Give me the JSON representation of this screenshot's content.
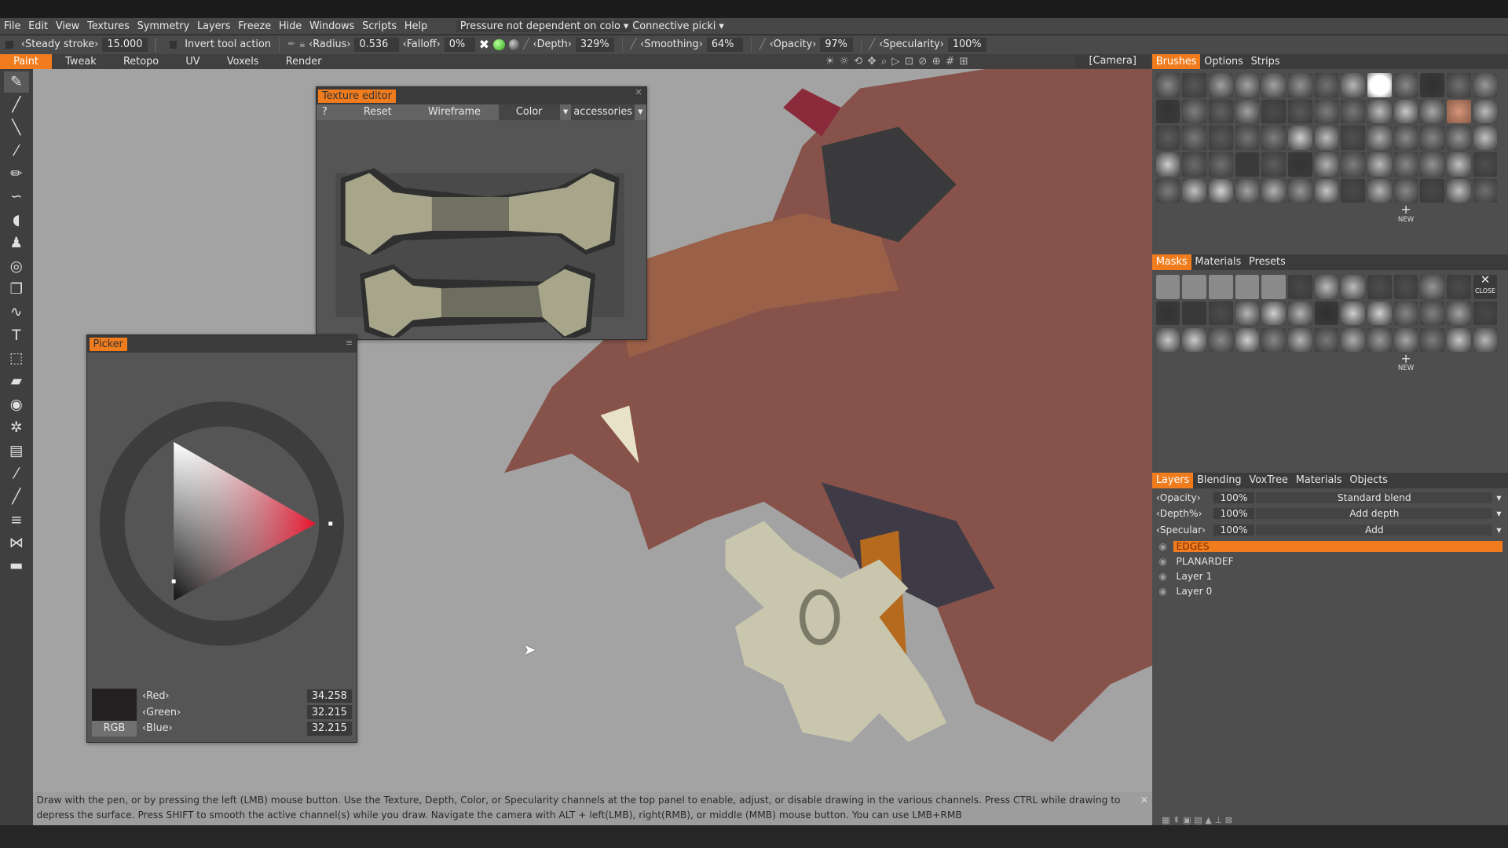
{
  "menu": [
    "File",
    "Edit",
    "View",
    "Textures",
    "Symmetry",
    "Layers",
    "Freeze",
    "Hide",
    "Windows",
    "Scripts",
    "Help"
  ],
  "menu_dropdowns": [
    "Pressure not dependent on colo",
    "Connective picki"
  ],
  "toolbar": {
    "steady_stroke_label": "‹Steady stroke›",
    "steady_stroke_value": "15.000",
    "invert_label": "Invert tool action",
    "radius_label": "‹Radius›",
    "radius_value": "0.536",
    "falloff_label": "‹Falloff›",
    "falloff_value": "0%",
    "depth_label": "‹Depth›",
    "depth_value": "329%",
    "smoothing_label": "‹Smoothing›",
    "smoothing_value": "64%",
    "opacity_label": "‹Opacity›",
    "opacity_value": "97%",
    "specularity_label": "‹Specularity›",
    "specularity_value": "100%"
  },
  "rooms": [
    "Paint",
    "Tweak",
    "Retopo",
    "UV",
    "Voxels",
    "Render"
  ],
  "active_room": "Paint",
  "camera": "[Camera]",
  "view_icons": [
    "☀",
    "☼",
    "⟲",
    "✥",
    "⌕",
    "▷",
    "⊡",
    "⊘",
    "⊕",
    "#",
    "⊞"
  ],
  "left_tools": [
    "brush-icon",
    "pen-icon",
    "line-icon",
    "airbrush-icon",
    "pencil-icon",
    "smudge-icon",
    "fill-icon",
    "clone-icon",
    "lasso-icon",
    "copy-icon",
    "curve-icon",
    "text-icon",
    "transform-icon",
    "eraser-icon",
    "eye-icon",
    "gear-icon",
    "ruler-icon",
    "picker-icon",
    "knife-icon",
    "stamp-icon",
    "butterfly-icon",
    "measure-icon"
  ],
  "left_tool_glyphs": [
    "✎",
    "╱",
    "╲",
    "⁄",
    "✏",
    "∽",
    "◖",
    "♟",
    "◎",
    "❐",
    "∿",
    "T",
    "⬚",
    "▰",
    "◉",
    "✲",
    "▤",
    "⁄",
    "╱",
    "≡",
    "⋈",
    "▬"
  ],
  "texture_editor": {
    "title": "Texture editor",
    "help": "?",
    "reset": "Reset",
    "wireframe": "Wireframe",
    "channel": "Color",
    "object": "accessories"
  },
  "picker": {
    "title": "Picker",
    "mode": "RGB",
    "red_label": "‹Red›",
    "red": "34.258",
    "green_label": "‹Green›",
    "green": "32.215",
    "blue_label": "‹Blue›",
    "blue": "32.215",
    "swatch": "#222020",
    "hue": "#e8102a"
  },
  "status": "Draw with the pen, or by pressing the left (LMB) mouse button. Use the Texture, Depth, Color, or Specularity channels at the top panel to enable, adjust, or disable drawing in the various channels. Press CTRL while drawing to depress the surface. Press SHIFT to smooth the active channel(s) while you draw. Navigate the camera with ALT + left(LMB), right(RMB), or middle (MMB) mouse button. You can use LMB+RMB",
  "brushes_tabs": [
    "Brushes",
    "Options",
    "Strips"
  ],
  "masks_tabs": [
    "Masks",
    "Materials",
    "Presets"
  ],
  "new_label": "NEW",
  "close_label": "CLOSE",
  "layers_tabs": [
    "Layers",
    "Blending",
    "VoxTree",
    "Materials",
    "Objects"
  ],
  "layer_props": [
    {
      "label": "‹Opacity›",
      "value": "100%",
      "blend": "Standard blend"
    },
    {
      "label": "‹Depth%›",
      "value": "100%",
      "blend": "Add depth"
    },
    {
      "label": "‹Specular›",
      "value": "100%",
      "blend": "Add"
    }
  ],
  "layers": [
    {
      "name": "EDGES",
      "active": true
    },
    {
      "name": "PLANARDEF"
    },
    {
      "name": "Layer 1"
    },
    {
      "name": "Layer 0"
    }
  ],
  "colors": {
    "accent": "#f07c1e",
    "panel": "#555555",
    "viewport": "#a3a3a3"
  }
}
